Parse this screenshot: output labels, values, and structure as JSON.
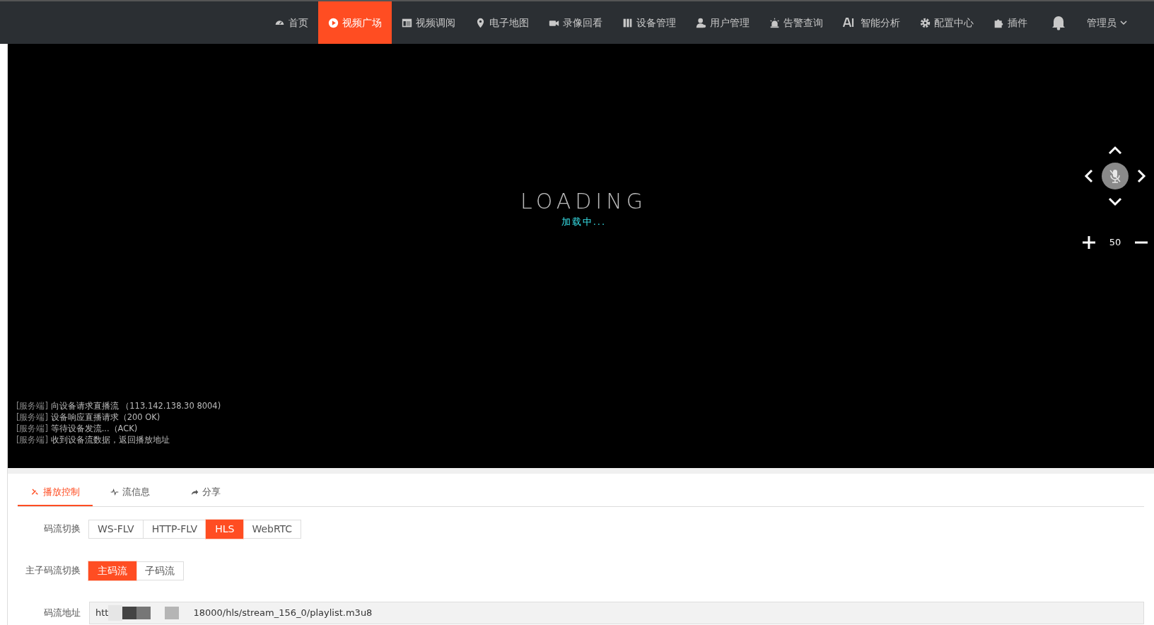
{
  "nav": {
    "items": [
      {
        "label": "首页",
        "selected": false
      },
      {
        "label": "视频广场",
        "selected": true
      },
      {
        "label": "视频调阅",
        "selected": false
      },
      {
        "label": "电子地图",
        "selected": false
      },
      {
        "label": "录像回看",
        "selected": false
      },
      {
        "label": "设备管理",
        "selected": false
      },
      {
        "label": "用户管理",
        "selected": false
      },
      {
        "label": "告警查询",
        "selected": false
      },
      {
        "label": "智能分析",
        "selected": false
      },
      {
        "label": "配置中心",
        "selected": false
      },
      {
        "label": "插件",
        "selected": false
      }
    ],
    "user": "管理员"
  },
  "player": {
    "loading_text": "LOADING",
    "loading_caption": "加载中...",
    "ptz": {
      "mic_muted": true,
      "speed": "50"
    },
    "logs": [
      {
        "source": "[服务端]",
        "text": "向设备请求直播流 （113.142.138.30 8004)"
      },
      {
        "source": "[服务端]",
        "text": "设备响应直播请求（200 OK)"
      },
      {
        "source": "[服务端]",
        "text": "等待设备发流...（ACK)"
      },
      {
        "source": "[服务端]",
        "text": "收到设备流数据，返回播放地址"
      }
    ]
  },
  "tabs": [
    {
      "label": "播放控制",
      "selected": true
    },
    {
      "label": "流信息",
      "selected": false
    },
    {
      "label": "分享",
      "selected": false
    }
  ],
  "stream_switch": {
    "label": "码流切换",
    "options": [
      {
        "label": "WS-FLV",
        "selected": false
      },
      {
        "label": "HTTP-FLV",
        "selected": false
      },
      {
        "label": "HLS",
        "selected": true
      },
      {
        "label": "WebRTC",
        "selected": false
      }
    ]
  },
  "substream": {
    "label": "主子码流切换",
    "options": [
      {
        "label": "主码流",
        "selected": true
      },
      {
        "label": "子码流",
        "selected": false
      }
    ]
  },
  "address": {
    "label": "码流地址",
    "value_start": "htt",
    "value_end": "18000/hls/stream_156_0/playlist.m3u8"
  }
}
